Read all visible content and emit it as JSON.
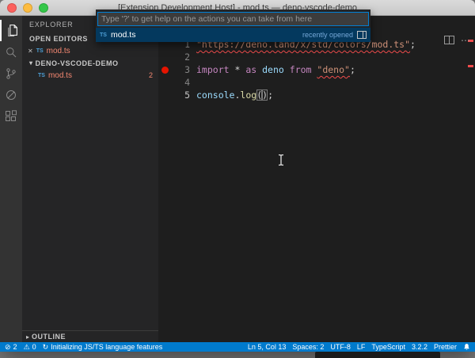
{
  "window": {
    "title": "[Extension Development Host] - mod.ts — deno-vscode-demo"
  },
  "quick_open": {
    "placeholder": "Type '?' to get help on the actions you can take from here",
    "selected_item": {
      "file_type": "TS",
      "label": "mod.ts",
      "hint": "recently opened"
    }
  },
  "activity_bar": {
    "icons": [
      "explorer-icon",
      "search-icon",
      "source-control-icon",
      "debug-icon",
      "extensions-icon"
    ]
  },
  "sidebar": {
    "title": "EXPLORER",
    "open_editors": {
      "header": "OPEN EDITORS",
      "item": {
        "close": "✕",
        "file_type": "TS",
        "label": "mod.ts"
      }
    },
    "folder": {
      "header": "DENO-VSCODE-DEMO",
      "chevron": "▾",
      "item": {
        "file_type": "TS",
        "label": "mod.ts",
        "problem_count": "2"
      }
    },
    "outline": {
      "header": "OUTLINE",
      "chevron": "▸"
    }
  },
  "editor": {
    "lines": [
      {
        "num": "1",
        "tokens": [
          {
            "t": "\"https://deno.land/x/std/colors/mod.ts\"",
            "c": "string",
            "squiggle": true
          },
          {
            "t": ";",
            "c": "plain"
          }
        ]
      },
      {
        "num": "2",
        "tokens": []
      },
      {
        "num": "3",
        "breakpoint": true,
        "tokens": [
          {
            "t": "import",
            "c": "keyword"
          },
          {
            "t": " * ",
            "c": "plain"
          },
          {
            "t": "as",
            "c": "keyword"
          },
          {
            "t": " ",
            "c": "plain"
          },
          {
            "t": "deno",
            "c": "variable"
          },
          {
            "t": " ",
            "c": "plain"
          },
          {
            "t": "from",
            "c": "keyword"
          },
          {
            "t": " ",
            "c": "plain"
          },
          {
            "t": "\"deno\"",
            "c": "string",
            "squiggle": true
          },
          {
            "t": ";",
            "c": "plain"
          }
        ]
      },
      {
        "num": "4",
        "tokens": []
      },
      {
        "num": "5",
        "active": true,
        "tokens": [
          {
            "t": "console",
            "c": "variable"
          },
          {
            "t": ".",
            "c": "plain"
          },
          {
            "t": "log",
            "c": "function"
          },
          {
            "t": "(",
            "c": "plain",
            "bracket": true
          },
          {
            "t": ")",
            "c": "plain",
            "bracket": true
          },
          {
            "t": ";",
            "c": "plain"
          }
        ]
      }
    ]
  },
  "editor_actions": {
    "more": "⋯"
  },
  "status_bar": {
    "left": [
      {
        "name": "error-count",
        "icon": "error-icon",
        "glyph": "⊘",
        "text": "2"
      },
      {
        "name": "warning-count",
        "icon": "warning-icon",
        "glyph": "⚠",
        "text": "0"
      },
      {
        "name": "language-status",
        "icon": "sync-icon",
        "glyph": "↻",
        "text": "Initializing JS/TS language features"
      }
    ],
    "right": [
      {
        "name": "cursor-position",
        "text": "Ln 5, Col 13"
      },
      {
        "name": "indentation",
        "text": "Spaces: 2"
      },
      {
        "name": "encoding",
        "text": "UTF-8"
      },
      {
        "name": "eol",
        "text": "LF"
      },
      {
        "name": "language-mode",
        "text": "TypeScript"
      },
      {
        "name": "ts-version",
        "text": "3.2.2"
      },
      {
        "name": "formatter",
        "text": "Prettier"
      }
    ]
  },
  "colors": {
    "status_bar": "#007acc",
    "error": "#f14c4c",
    "breakpoint": "#e51400",
    "string": "#ce9178",
    "keyword": "#c586c0",
    "selection_row": "#04395e"
  }
}
